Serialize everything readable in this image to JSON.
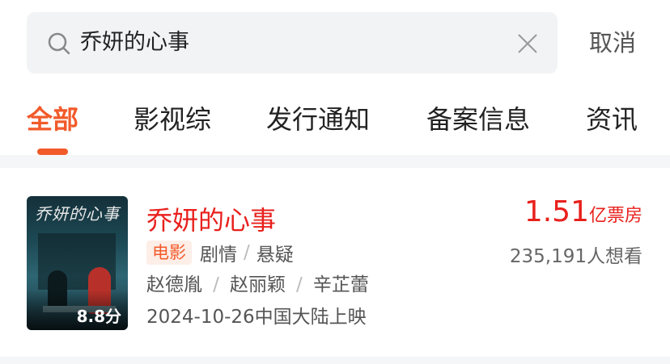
{
  "search": {
    "query": "乔妍的心事",
    "cancel_label": "取消"
  },
  "tabs": [
    {
      "label": "全部",
      "active": true
    },
    {
      "label": "影视综",
      "active": false
    },
    {
      "label": "发行通知",
      "active": false
    },
    {
      "label": "备案信息",
      "active": false
    },
    {
      "label": "资讯",
      "active": false
    }
  ],
  "result": {
    "title": "乔妍的心事",
    "poster_title": "乔妍的心事",
    "score": "8.8分",
    "type": "电影",
    "genres": [
      "剧情",
      "悬疑"
    ],
    "cast": [
      "赵德胤",
      "赵丽颖",
      "辛芷蕾"
    ],
    "release": "2024-10-26中国大陆上映",
    "box_office_value": "1.51",
    "box_office_unit": "亿票房",
    "want_to_see": "235,191人想看"
  },
  "colors": {
    "accent": "#f25a2a",
    "title_red": "#e8201c",
    "badge_bg": "#fdeee8",
    "search_bg": "#f2f3f5"
  },
  "icons": {
    "search": "search-icon",
    "clear": "close-icon"
  }
}
